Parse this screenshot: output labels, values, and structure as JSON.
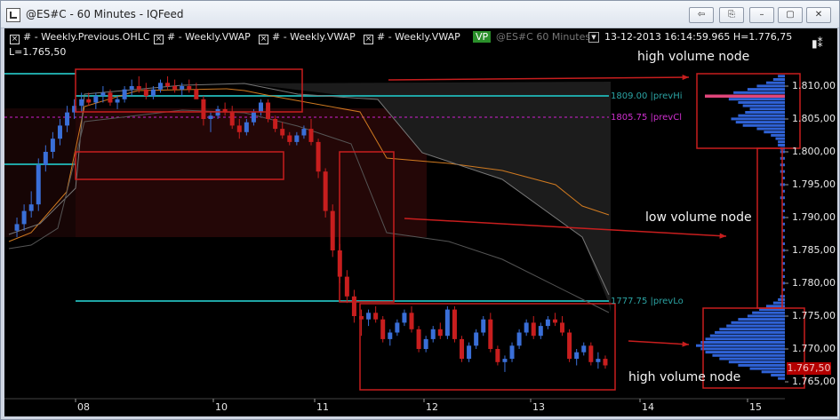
{
  "window": {
    "title": "@ES#C - 60 Minutes - IQFeed"
  },
  "titlebar_buttons": {
    "btn1": "⇦",
    "btn2": "⎘",
    "minimize": "–",
    "restore": "▢",
    "close": "✕"
  },
  "legend": {
    "items": [
      "# - Weekly.Previous.OHLC",
      "# - Weekly.VWAP",
      "# - Weekly.VWAP",
      "# - Weekly.VWAP"
    ],
    "vp_badge": "VP",
    "vp_symbol": "@ES#C  60 Minutes",
    "datetime": "13-12-2013  16:14:59.965  H=1.776,75",
    "low": "L=1.765,50"
  },
  "annotations": {
    "top": "high volume node",
    "middle": "low volume node",
    "bottom": "high volume node"
  },
  "levels": {
    "prev_hi": "1809.00 |prevHi",
    "prev_cl": "1805.75 |prevCl",
    "prev_lo": "1777.75 |prevLo"
  },
  "current_price": "1.767,50",
  "colors": {
    "background": "#000000",
    "cyan_level": "#1fa5a5",
    "magenta_level": "#d020d0",
    "up_candle": "#3a6fd8",
    "down_candle": "#c81e1e",
    "annotation_box": "#c81e1e",
    "volume_profile": "#2f62d6"
  },
  "chart_data": {
    "type": "candlestick",
    "y_axis": {
      "ticks": [
        "1.810,00",
        "1.805,00",
        "1.800,00",
        "1.795,00",
        "1.790,00",
        "1.785,00",
        "1.780,00",
        "1.775,00",
        "1.770,00",
        "1.765,00"
      ],
      "range": [
        1764,
        1814
      ]
    },
    "x_axis": {
      "ticks": [
        "08",
        "10",
        "11",
        "12",
        "13",
        "14",
        "15"
      ]
    },
    "candles": [
      [
        1788,
        1790,
        1787,
        1789
      ],
      [
        1789,
        1792,
        1788,
        1791
      ],
      [
        1791,
        1794,
        1790,
        1792
      ],
      [
        1792,
        1799,
        1791,
        1798
      ],
      [
        1798,
        1801,
        1797,
        1800
      ],
      [
        1800,
        1803,
        1799,
        1802
      ],
      [
        1802,
        1805,
        1801,
        1804
      ],
      [
        1804,
        1807,
        1803,
        1806
      ],
      [
        1806,
        1808,
        1805,
        1807
      ],
      [
        1807,
        1809,
        1806,
        1808
      ],
      [
        1808,
        1809,
        1807,
        1807.5
      ],
      [
        1807.5,
        1809,
        1806.5,
        1808.5
      ],
      [
        1808.5,
        1810,
        1807.5,
        1809
      ],
      [
        1809,
        1809.5,
        1807,
        1807.5
      ],
      [
        1807.5,
        1808.5,
        1806.5,
        1808
      ],
      [
        1808,
        1810,
        1807.5,
        1809.5
      ],
      [
        1809.5,
        1811,
        1808.5,
        1810
      ],
      [
        1810,
        1811.5,
        1809,
        1809.5
      ],
      [
        1809.5,
        1810.5,
        1808,
        1808.5
      ],
      [
        1808.5,
        1810,
        1808,
        1809.5
      ],
      [
        1809.5,
        1811,
        1809,
        1810.5
      ],
      [
        1810.5,
        1811.5,
        1809.5,
        1810
      ],
      [
        1810,
        1811,
        1809,
        1809.5
      ],
      [
        1809.5,
        1810.5,
        1808.5,
        1810
      ],
      [
        1810,
        1811,
        1809,
        1809.5
      ],
      [
        1809.5,
        1810.5,
        1808,
        1808
      ],
      [
        1808,
        1808.5,
        1804,
        1805
      ],
      [
        1805,
        1806,
        1803,
        1805.5
      ],
      [
        1805.5,
        1807,
        1805,
        1806.5
      ],
      [
        1806.5,
        1807.5,
        1805.5,
        1806
      ],
      [
        1806,
        1807,
        1803.5,
        1804
      ],
      [
        1804,
        1805,
        1802,
        1803
      ],
      [
        1803,
        1805,
        1802.5,
        1804.5
      ],
      [
        1804.5,
        1806.5,
        1804,
        1806
      ],
      [
        1806,
        1808,
        1805.5,
        1807.5
      ],
      [
        1807.5,
        1808,
        1804.5,
        1805
      ],
      [
        1805,
        1805.5,
        1803,
        1803.5
      ],
      [
        1803.5,
        1804.5,
        1802,
        1802.5
      ],
      [
        1802.5,
        1803,
        1801,
        1801.5
      ],
      [
        1801.5,
        1803,
        1801,
        1802.5
      ],
      [
        1802.5,
        1804,
        1802,
        1803.5
      ],
      [
        1803.5,
        1805,
        1801,
        1801.5
      ],
      [
        1801.5,
        1802,
        1796,
        1797
      ],
      [
        1797,
        1797.5,
        1790,
        1791
      ],
      [
        1791,
        1792,
        1784,
        1785
      ],
      [
        1785,
        1786,
        1780,
        1781
      ],
      [
        1781,
        1782,
        1777,
        1778
      ],
      [
        1778,
        1779,
        1774,
        1775
      ],
      [
        1775,
        1776,
        1772,
        1774.5
      ],
      [
        1774.5,
        1776,
        1773.5,
        1775.5
      ],
      [
        1775.5,
        1776.5,
        1774,
        1774.5
      ],
      [
        1774.5,
        1775,
        1771,
        1771.5
      ],
      [
        1771.5,
        1773,
        1770.5,
        1772.5
      ],
      [
        1772.5,
        1774.5,
        1772,
        1774
      ],
      [
        1774,
        1776,
        1773.5,
        1775.5
      ],
      [
        1775.5,
        1776.5,
        1772.5,
        1773
      ],
      [
        1773,
        1773.5,
        1769.5,
        1770
      ],
      [
        1770,
        1772,
        1769.5,
        1771.5
      ],
      [
        1771.5,
        1773.5,
        1771,
        1773
      ],
      [
        1773,
        1774,
        1771.5,
        1772
      ],
      [
        1772,
        1776.5,
        1771.5,
        1776
      ],
      [
        1776,
        1776.5,
        1771,
        1771.5
      ],
      [
        1771.5,
        1772,
        1768,
        1768.5
      ],
      [
        1768.5,
        1771,
        1768,
        1770.5
      ],
      [
        1770.5,
        1773,
        1770,
        1772.5
      ],
      [
        1772.5,
        1775,
        1772,
        1774.5
      ],
      [
        1774.5,
        1775.5,
        1769.5,
        1770
      ],
      [
        1770,
        1770.5,
        1767.5,
        1768
      ],
      [
        1768,
        1769,
        1766.5,
        1768.5
      ],
      [
        1768.5,
        1771,
        1768,
        1770.5
      ],
      [
        1770.5,
        1773,
        1770,
        1772.5
      ],
      [
        1772.5,
        1774.5,
        1772,
        1774
      ],
      [
        1774,
        1775,
        1771.5,
        1772
      ],
      [
        1772,
        1774,
        1771.5,
        1773.5
      ],
      [
        1773.5,
        1775,
        1773,
        1774.5
      ],
      [
        1774.5,
        1775.5,
        1773.5,
        1774
      ],
      [
        1774,
        1775,
        1772,
        1772.5
      ],
      [
        1772.5,
        1773,
        1768,
        1768.5
      ],
      [
        1768.5,
        1770,
        1767.5,
        1769.5
      ],
      [
        1769.5,
        1771,
        1769,
        1770.5
      ],
      [
        1770.5,
        1771,
        1767.5,
        1768
      ],
      [
        1768,
        1769.5,
        1767,
        1768.5
      ],
      [
        1768.5,
        1769,
        1767,
        1767.5
      ]
    ],
    "volume_profile": [
      [
        1811.5,
        3
      ],
      [
        1811,
        5
      ],
      [
        1810.5,
        8
      ],
      [
        1810,
        12
      ],
      [
        1809.5,
        16
      ],
      [
        1809,
        22
      ],
      [
        1808.5,
        28
      ],
      [
        1808,
        24
      ],
      [
        1807.5,
        20
      ],
      [
        1807,
        18
      ],
      [
        1806.5,
        15
      ],
      [
        1806,
        17
      ],
      [
        1805.5,
        20
      ],
      [
        1805,
        23
      ],
      [
        1804.5,
        21
      ],
      [
        1804,
        18
      ],
      [
        1803.5,
        12
      ],
      [
        1803,
        9
      ],
      [
        1802.5,
        6
      ],
      [
        1802,
        4
      ],
      [
        1801.5,
        3
      ],
      [
        1801,
        3
      ],
      [
        1800.5,
        2
      ],
      [
        1800,
        2
      ],
      [
        1799,
        2
      ],
      [
        1798,
        2
      ],
      [
        1797,
        2
      ],
      [
        1796,
        1
      ],
      [
        1795,
        2
      ],
      [
        1794,
        1
      ],
      [
        1793,
        2
      ],
      [
        1792,
        1
      ],
      [
        1791,
        1
      ],
      [
        1790,
        1
      ],
      [
        1789,
        1
      ],
      [
        1788,
        1
      ],
      [
        1787,
        1
      ],
      [
        1786,
        1
      ],
      [
        1785,
        1
      ],
      [
        1784,
        1
      ],
      [
        1783,
        1
      ],
      [
        1782,
        1
      ],
      [
        1781,
        1
      ],
      [
        1780,
        1
      ],
      [
        1779,
        1
      ],
      [
        1778,
        2
      ],
      [
        1777.5,
        3
      ],
      [
        1777,
        5
      ],
      [
        1776.5,
        8
      ],
      [
        1776,
        11
      ],
      [
        1775.5,
        14
      ],
      [
        1775,
        16
      ],
      [
        1774.5,
        20
      ],
      [
        1774,
        23
      ],
      [
        1773.5,
        25
      ],
      [
        1773,
        28
      ],
      [
        1772.5,
        30
      ],
      [
        1772,
        32
      ],
      [
        1771.5,
        34
      ],
      [
        1771,
        36
      ],
      [
        1770.5,
        38
      ],
      [
        1770,
        36
      ],
      [
        1769.5,
        34
      ],
      [
        1769,
        31
      ],
      [
        1768.5,
        28
      ],
      [
        1768,
        24
      ],
      [
        1767.5,
        20
      ],
      [
        1767,
        15
      ],
      [
        1766.5,
        10
      ],
      [
        1766,
        6
      ],
      [
        1765.5,
        3
      ]
    ],
    "poc": 1808.5
  }
}
